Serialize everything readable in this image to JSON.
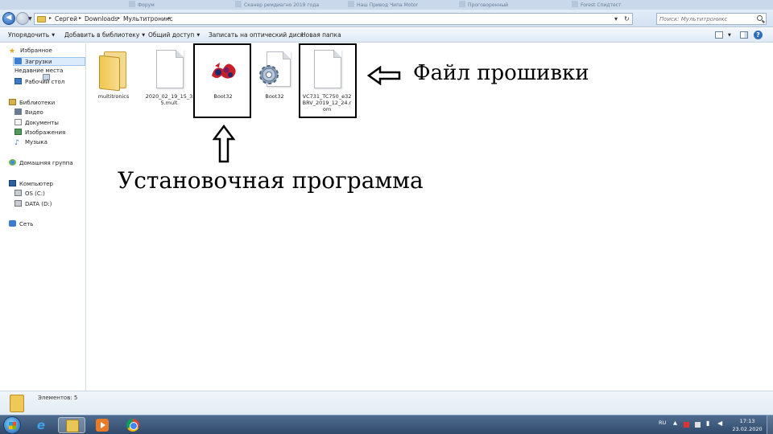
{
  "background_tabs": [
    "Форум",
    "Сканер ремдиагно 2019 года",
    "Наш Привод Чипа Motor",
    "Проговоренный",
    "Forest Спидтест"
  ],
  "address": {
    "crumbs": [
      "Сергей",
      "Downloads",
      "Мультитроникс"
    ],
    "search_placeholder": "Поиск: Мультитроникс"
  },
  "toolbar": {
    "organize": "Упорядочить",
    "add_to_library": "Добавить в библиотеку",
    "share": "Общий доступ",
    "burn": "Записать на оптический диск",
    "new_folder": "Новая папка"
  },
  "nav": {
    "favorites": "Избранное",
    "downloads": "Загрузки",
    "recent": "Недавние места",
    "desktop": "Рабочий стол",
    "libraries": "Библиотеки",
    "video": "Видео",
    "documents": "Документы",
    "pictures": "Изображения",
    "music": "Музыка",
    "homegroup": "Домашняя группа",
    "computer": "Компьютер",
    "drive_c": "OS (C:)",
    "drive_d": "DATA (D:)",
    "network": "Сеть"
  },
  "files": [
    {
      "name": "multitronics",
      "kind": "folder"
    },
    {
      "name": "2020_02_19_15_35.mult",
      "kind": "document"
    },
    {
      "name": "Boot32",
      "kind": "application"
    },
    {
      "name": "Boot32",
      "kind": "config"
    },
    {
      "name": "VC731_TC750_e32BRV_2019_12_24.rom",
      "kind": "document"
    }
  ],
  "annotations": {
    "firmware": "Файл прошивки",
    "installer": "Установочная программа"
  },
  "status": {
    "count": "Элементов: 5"
  },
  "taskbar": {
    "lang": "RU",
    "time": "17:13",
    "date": "23.02.2020"
  }
}
